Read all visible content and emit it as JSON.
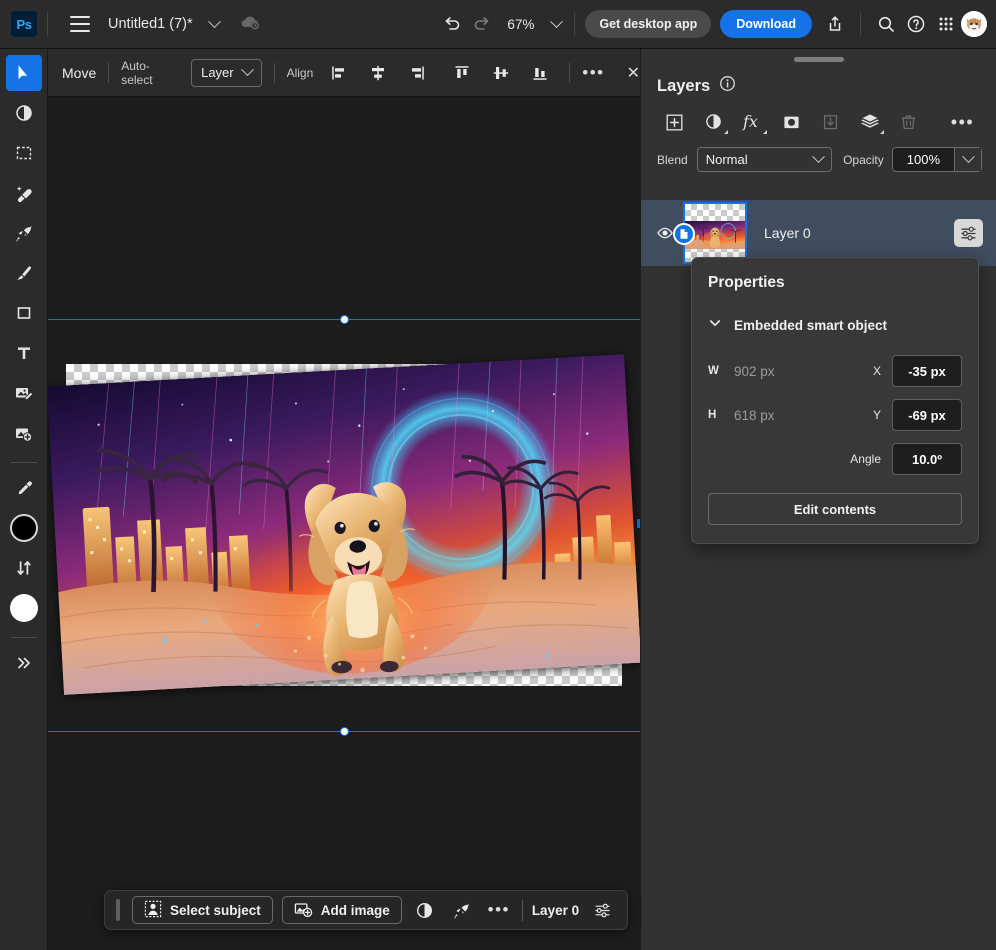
{
  "topbar": {
    "logo": "Ps",
    "menu_icon": "hamburger-icon",
    "doc_title": "Untitled1 (7)*",
    "cloud_icon": "cloud-sync-icon",
    "undo_icon": "undo-icon",
    "redo_icon": "redo-icon",
    "zoom_level": "67%",
    "get_desktop_app": "Get desktop app",
    "download": "Download",
    "share_icon": "share-icon",
    "search_icon": "search-icon",
    "help_icon": "help-icon",
    "apps_icon": "app-grid-icon",
    "avatar_icon": "cat-avatar"
  },
  "toolbar": {
    "items": [
      {
        "name": "move-tool",
        "icon": "cursor-arrow",
        "active": true
      },
      {
        "name": "adjustments-tool",
        "icon": "half-circle"
      },
      {
        "name": "marquee-select-tool",
        "icon": "dashed-square"
      },
      {
        "name": "spot-heal-tool",
        "icon": "magic-wand-sparkle"
      },
      {
        "name": "generative-tool",
        "icon": "rocket"
      },
      {
        "name": "brush-tool",
        "icon": "paintbrush"
      },
      {
        "name": "shape-tool",
        "icon": "square-outline"
      },
      {
        "name": "type-tool",
        "icon": "letter-t"
      },
      {
        "name": "image-edit-tool",
        "icon": "image-pencil"
      },
      {
        "name": "add-image-tool",
        "icon": "image-plus"
      },
      {
        "name": "eyedropper-tool",
        "icon": "eyedropper"
      },
      {
        "name": "foreground-color",
        "icon": "black-circle"
      },
      {
        "name": "swap-colors",
        "icon": "swap-arrows"
      },
      {
        "name": "background-color",
        "icon": "white-circle"
      },
      {
        "name": "more-tools",
        "icon": "double-chevron-right"
      }
    ]
  },
  "options_bar": {
    "tool_name": "Move",
    "auto_select_label": "Auto-select",
    "auto_select_value": "Layer",
    "align_label": "Align",
    "align_buttons": [
      "align-left-edges",
      "align-horizontal-centers",
      "align-right-edges",
      "align-top-edges",
      "align-vertical-centers",
      "align-bottom-edges"
    ],
    "more_label": "•••",
    "close_label": "✕"
  },
  "canvas": {
    "artboard_alt": "golden retriever puppy running on neon cyberpunk beach with palm trees and city skyline",
    "guides": [
      "top-guide",
      "bottom-guide"
    ],
    "handles": [
      "top-center-handle",
      "bottom-center-handle",
      "right-edge-handle"
    ]
  },
  "layers_panel": {
    "title": "Layers",
    "info_icon": "info-icon",
    "tools": [
      {
        "name": "add-layer-button",
        "icon": "plus-square"
      },
      {
        "name": "adjustment-layer-button",
        "icon": "half-circle"
      },
      {
        "name": "layer-effects-button",
        "icon": "fx"
      },
      {
        "name": "layer-mask-button",
        "icon": "mask-circle"
      },
      {
        "name": "clipping-mask-button",
        "icon": "clip-arrow",
        "disabled": true
      },
      {
        "name": "group-layers-button",
        "icon": "stack"
      },
      {
        "name": "delete-layer-button",
        "icon": "trash",
        "disabled": true
      },
      {
        "name": "layers-more-button",
        "icon": "ellipsis"
      }
    ],
    "blend_label": "Blend",
    "blend_value": "Normal",
    "opacity_label": "Opacity",
    "opacity_value": "100%",
    "layers": [
      {
        "name": "Layer 0",
        "visible": true,
        "badge": "smart-object-badge",
        "properties_button": "layer-properties-button"
      }
    ]
  },
  "properties": {
    "title": "Properties",
    "section_title": "Embedded smart object",
    "collapse_icon": "chevron-down-icon",
    "w_label": "W",
    "w_value": "902 px",
    "h_label": "H",
    "h_value": "618 px",
    "x_label": "X",
    "x_value": "-35 px",
    "y_label": "Y",
    "y_value": "-69 px",
    "angle_label": "Angle",
    "angle_value": "10.0º",
    "edit_contents": "Edit contents"
  },
  "float_toolbar": {
    "grip": "drag-grip",
    "select_subject": "Select subject",
    "add_image": "Add image",
    "adjust_icon": "half-circle",
    "generative_icon": "rocket",
    "more_icon": "ellipsis",
    "layer_label": "Layer 0",
    "props_icon": "sliders-icon"
  },
  "colors": {
    "accent_blue": "#1473e6",
    "panel_bg": "#323232",
    "chrome_bg": "#2b2b2b",
    "canvas_bg": "#1d1d1d",
    "layer_selected_bg": "#3f4d5e"
  }
}
